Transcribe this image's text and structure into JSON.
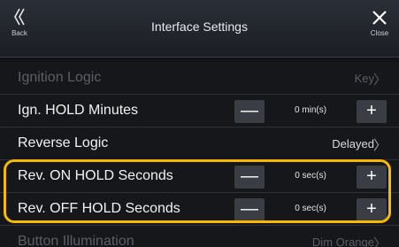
{
  "header": {
    "title": "Interface Settings",
    "back_label": "Back",
    "close_label": "Close"
  },
  "rows": [
    {
      "label": "Ignition Logic",
      "value": "Key",
      "type": "link",
      "state": "disabled"
    },
    {
      "label": "Ign. HOLD Minutes",
      "value": "0 min(s)",
      "type": "stepper"
    },
    {
      "label": "Reverse Logic",
      "value": "Delayed",
      "type": "link"
    },
    {
      "label": "Rev. ON HOLD Seconds",
      "value": "0 sec(s)",
      "type": "stepper"
    },
    {
      "label": "Rev. OFF HOLD Seconds",
      "value": "0 sec(s)",
      "type": "stepper"
    },
    {
      "label": "Button Illumination",
      "value": "Dim Orange",
      "type": "link",
      "state": "disabled"
    }
  ],
  "stepper_symbols": {
    "minus": "—",
    "plus": "+"
  },
  "arrow_symbol": "〉",
  "colors": {
    "highlight": "#f6b800",
    "background": "#101216"
  }
}
